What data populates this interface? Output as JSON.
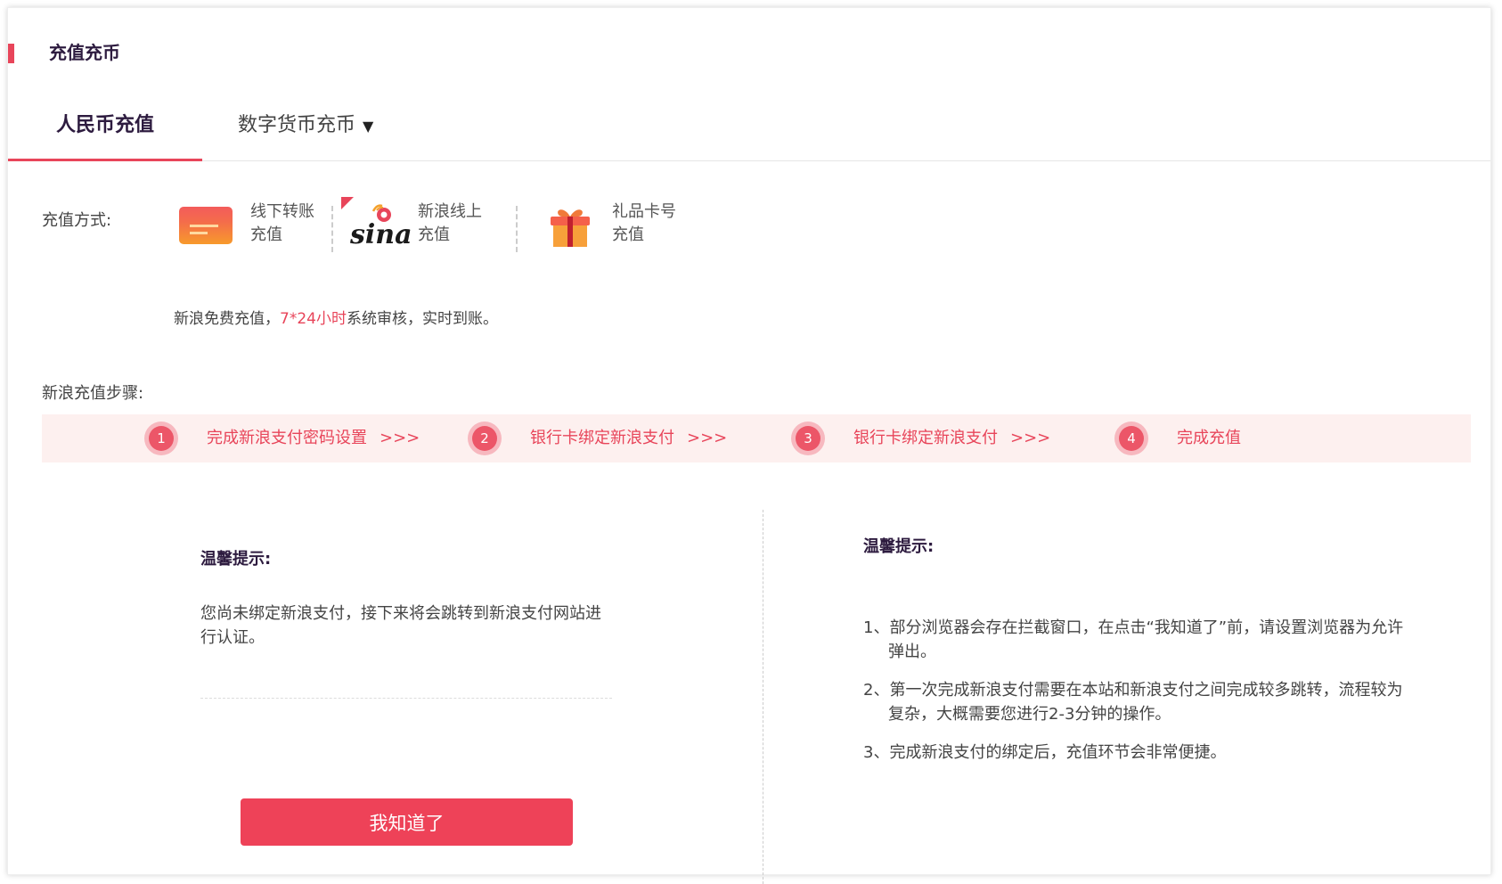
{
  "page": {
    "title": "充值充币",
    "accent_color": "#e8455a"
  },
  "tabs": [
    {
      "label": "人民币充值",
      "active": true
    },
    {
      "label": "数字货币充币",
      "active": false,
      "dropdown": true
    }
  ],
  "tab_caret": "▼",
  "recharge": {
    "method_label": "充值方式:",
    "methods": [
      {
        "line1": "线下转账",
        "line2": "充值",
        "icon": "bank-card-icon"
      },
      {
        "line1": "新浪线上",
        "line2": "充值",
        "icon": "sina-logo-icon",
        "selected": true
      },
      {
        "line1": "礼品卡号",
        "line2": "充值",
        "icon": "gift-box-icon"
      }
    ],
    "sina_logo_text": "sina",
    "note_prefix": "新浪免费充值，",
    "note_highlight": "7*24小时",
    "note_suffix": "系统审核，实时到账。"
  },
  "steps": {
    "label": "新浪充值步骤:",
    "arrows": ">>>",
    "items": [
      {
        "num": "1",
        "text": "完成新浪支付密码设置"
      },
      {
        "num": "2",
        "text": "银行卡绑定新浪支付"
      },
      {
        "num": "3",
        "text": "银行卡绑定新浪支付"
      },
      {
        "num": "4",
        "text": "完成充值"
      }
    ]
  },
  "tip_left": {
    "title": "温馨提示:",
    "body": "您尚未绑定新浪支付，接下来将会跳转到新浪支付网站进行认证。",
    "button": "我知道了"
  },
  "tip_right": {
    "title": "温馨提示:",
    "items": [
      "1、部分浏览器会存在拦截窗口，在点击“我知道了”前，请设置浏览器为允许弹出。",
      "2、第一次完成新浪支付需要在本站和新浪支付之间完成较多跳转，流程较为复杂，大概需要您进行2-3分钟的操作。",
      "3、完成新浪支付的绑定后，充值环节会非常便捷。"
    ]
  }
}
